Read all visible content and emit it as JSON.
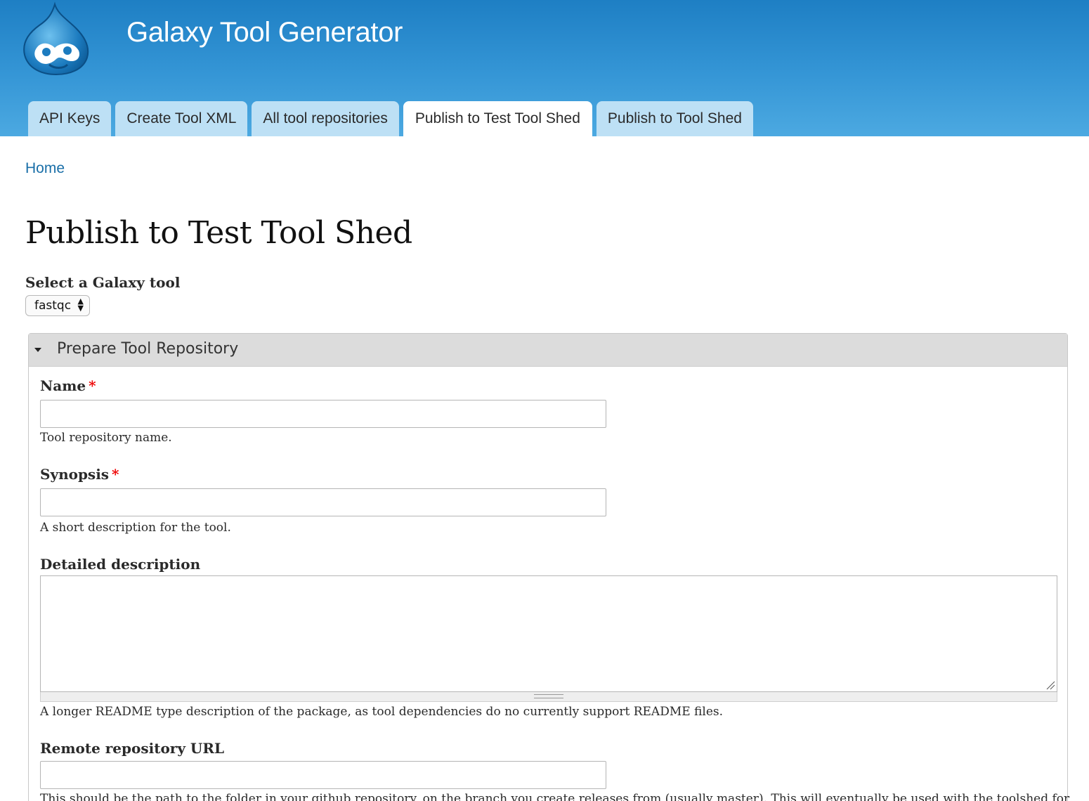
{
  "site": {
    "name": "Galaxy Tool Generator",
    "logo_icon": "drupal-drop-logo"
  },
  "tabs": [
    {
      "label": "API Keys",
      "active": false
    },
    {
      "label": "Create Tool XML",
      "active": false
    },
    {
      "label": "All tool repositories",
      "active": false
    },
    {
      "label": "Publish to Test Tool Shed",
      "active": true
    },
    {
      "label": "Publish to Tool Shed",
      "active": false
    }
  ],
  "breadcrumb": {
    "home": "Home"
  },
  "page": {
    "title": "Publish to Test Tool Shed"
  },
  "tool_select": {
    "label": "Select a Galaxy tool",
    "value": "fastqc",
    "arrows": "▲\n▼"
  },
  "fieldset": {
    "legend": "Prepare Tool Repository",
    "fields": {
      "name": {
        "label": "Name",
        "required_mark": "*",
        "value": "",
        "description": "Tool repository name."
      },
      "synopsis": {
        "label": "Synopsis",
        "required_mark": "*",
        "value": "",
        "description": "A short description for the tool."
      },
      "detailed_description": {
        "label": "Detailed description",
        "value": "",
        "description": "A longer README type description of the package, as tool dependencies do no currently support README files."
      },
      "remote_repository_url": {
        "label": "Remote repository URL",
        "value": "",
        "description": "This should be the path to the folder in your github repository, on the branch you create releases from (usually master). This will eventually be used with the toolshed for"
      }
    }
  },
  "colors": {
    "header_top": "#1e7fc4",
    "header_bottom": "#4ca9e1",
    "tab_bg": "#bde0f5",
    "link": "#1a6fa8",
    "required": "#ee0000"
  }
}
